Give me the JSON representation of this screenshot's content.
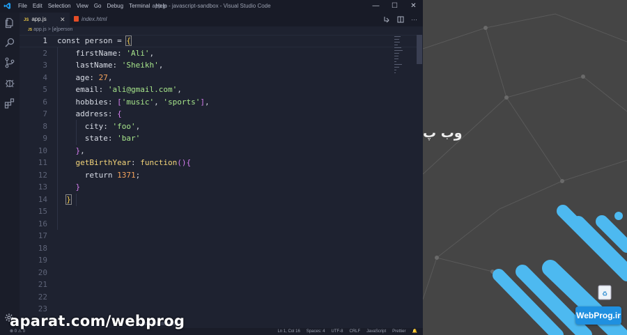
{
  "window": {
    "title": "app.js - javascript-sandbox - Visual Studio Code",
    "menu": [
      "File",
      "Edit",
      "Selection",
      "View",
      "Go",
      "Debug",
      "Terminal",
      "Help"
    ],
    "controls": [
      "—",
      "☐",
      "✕"
    ]
  },
  "tabs": [
    {
      "icon": "JS",
      "label": "app.js",
      "active": true,
      "close": "✕"
    },
    {
      "icon": "html5",
      "label": "index.html",
      "active": false
    }
  ],
  "breadcrumb": {
    "icon": "JS",
    "file": "app.js",
    "sep": ">",
    "symbol": "[ø]person"
  },
  "editor": {
    "line_numbers": [
      "1",
      "2",
      "3",
      "4",
      "5",
      "6",
      "7",
      "8",
      "9",
      "10",
      "11",
      "12",
      "13",
      "14",
      "15",
      "16",
      "17",
      "18",
      "19",
      "20",
      "21",
      "22",
      "23"
    ],
    "current_line": "1",
    "lines": [
      "const person = {",
      "    firstName: 'Ali',",
      "    lastName: 'Sheikh',",
      "    age: 27,",
      "    email: 'ali@gmail.com',",
      "    hobbies: ['music', 'sports'],",
      "    address: {",
      "      city: 'foo',",
      "      state: 'bar'",
      "    },",
      "    getBirthYear: function(){",
      "      return 1371;",
      "    }",
      "  }"
    ]
  },
  "statusbar": {
    "left": "⊗ 0 ⚠ 0",
    "items": [
      "Ln 1, Col 16",
      "Spaces: 4",
      "UTF-8",
      "CRLF",
      "JavaScript",
      "Prettier",
      "🔔"
    ]
  },
  "background": {
    "persian_text": "وب پ"
  },
  "badge": {
    "label": "WebProg.ir"
  },
  "watermark": {
    "text": "aparat.com/webprog"
  },
  "colors": {
    "accent": "#1f90e0",
    "editor_bg": "#1e2230",
    "string": "#a6e48a",
    "number": "#f5a35c",
    "function": "#f4d57a"
  }
}
